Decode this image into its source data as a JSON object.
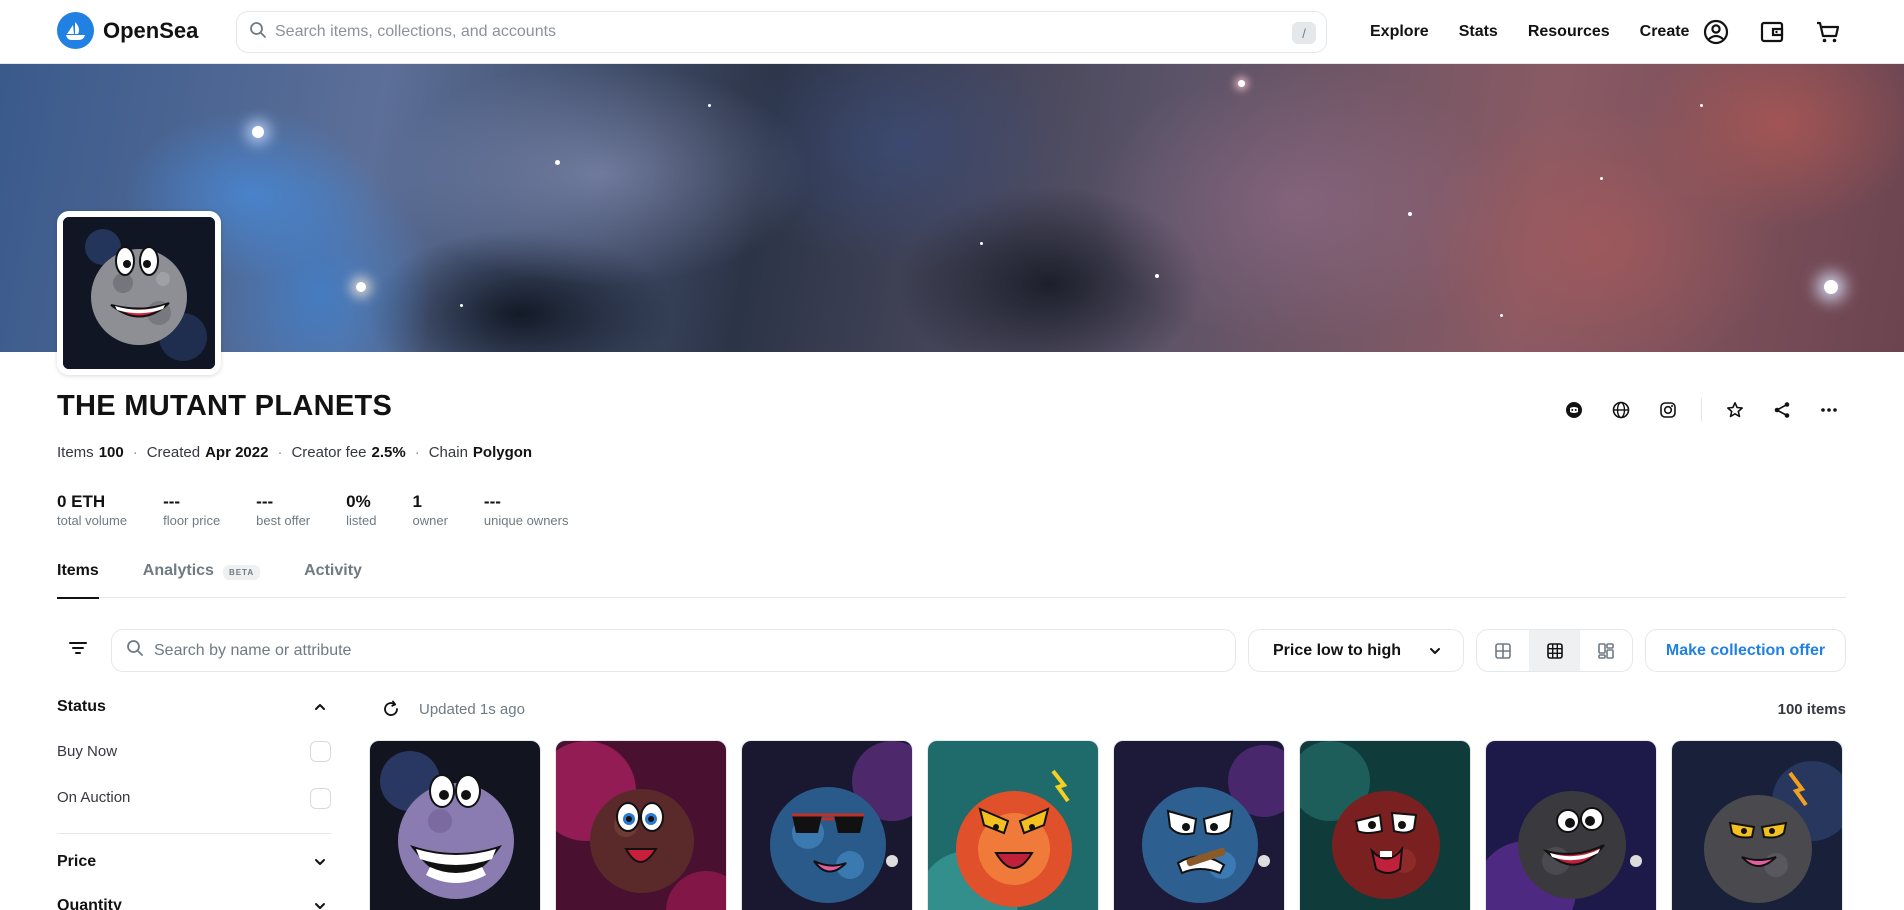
{
  "header": {
    "brand": "OpenSea",
    "search_placeholder": "Search items, collections, and accounts",
    "search_shortcut": "/",
    "nav": [
      "Explore",
      "Stats",
      "Resources",
      "Create"
    ],
    "icons": [
      "account-icon",
      "wallet-icon",
      "cart-icon"
    ]
  },
  "collection": {
    "name": "THE MUTANT PLANETS",
    "meta": [
      {
        "label": "Items",
        "value": "100"
      },
      {
        "label": "Created",
        "value": "Apr 2022"
      },
      {
        "label": "Creator fee",
        "value": "2.5%"
      },
      {
        "label": "Chain",
        "value": "Polygon"
      }
    ],
    "stats": [
      {
        "value": "0 ETH",
        "label": "total volume"
      },
      {
        "value": "---",
        "label": "floor price"
      },
      {
        "value": "---",
        "label": "best offer"
      },
      {
        "value": "0%",
        "label": "listed"
      },
      {
        "value": "1",
        "label": "owner"
      },
      {
        "value": "---",
        "label": "unique owners"
      }
    ],
    "action_icons": [
      "discord-icon",
      "globe-icon",
      "instagram-icon",
      "star-icon",
      "share-icon",
      "more-icon"
    ]
  },
  "tabs": [
    {
      "label": "Items",
      "active": true
    },
    {
      "label": "Analytics",
      "badge": "BETA"
    },
    {
      "label": "Activity"
    }
  ],
  "toolbar": {
    "search_placeholder": "Search by name or attribute",
    "sort_value": "Price low to high",
    "offer_button": "Make collection offer"
  },
  "sidebar": {
    "status_heading": "Status",
    "status_options": [
      "Buy Now",
      "On Auction"
    ],
    "price_heading": "Price",
    "quantity_heading": "Quantity"
  },
  "results": {
    "updated": "Updated 1s ago",
    "count": "100 items"
  },
  "colors": {
    "accent": "#2081e2",
    "text": "#121212",
    "muted": "#707a83",
    "border": "#e5e8eb"
  }
}
